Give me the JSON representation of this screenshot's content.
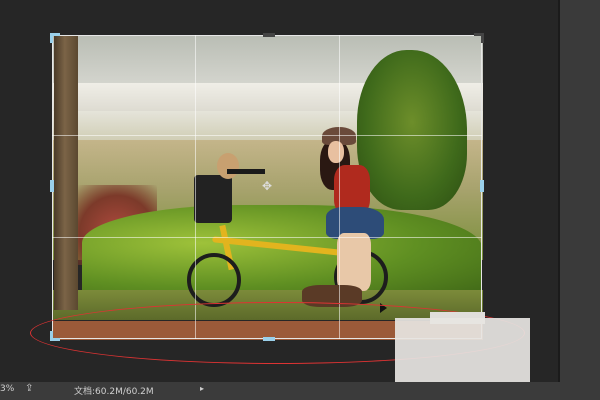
{
  "canvas": {
    "tool": "crop",
    "grid": "rule-of-thirds",
    "annotation_color": "#d33333",
    "handle_color": "#9ad0ea"
  },
  "status_bar": {
    "zoom": "3%",
    "doc_info": "文档:60.2M/60.2M",
    "share_icon": "share-icon",
    "menu_arrow": "▸"
  },
  "crosshair_glyph": "✥"
}
